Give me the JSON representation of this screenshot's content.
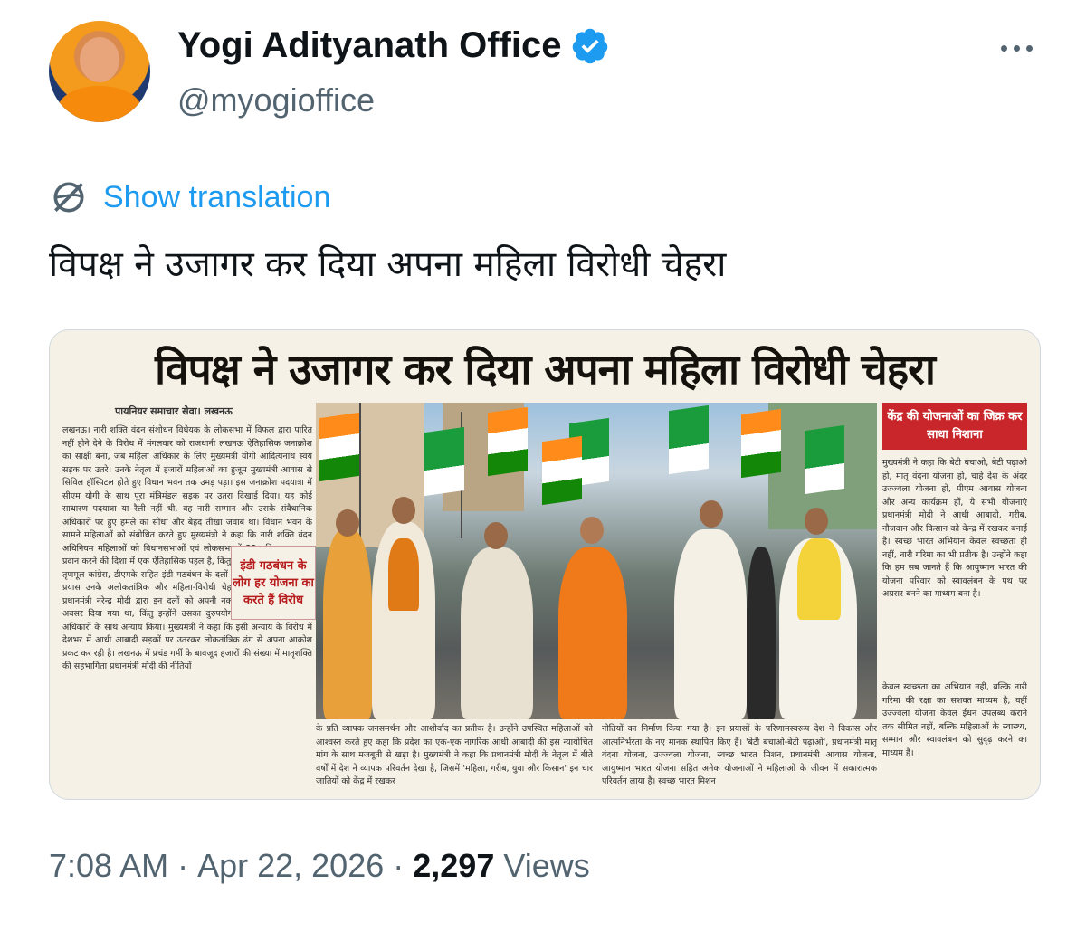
{
  "author": {
    "display_name": "Yogi Adityanath Office",
    "handle": "@myogioffice",
    "verified": true
  },
  "actions": {
    "more_icon": "more-horizontal-icon",
    "show_translation_label": "Show translation"
  },
  "tweet": {
    "text": "विपक्ष ने उजागर कर दिया अपना महिला विरोधी चेहरा"
  },
  "media": {
    "headline": "विपक्ष ने उजागर कर दिया अपना महिला विरोधी चेहरा",
    "byline": "पायनियर समाचार सेवा। लखनऊ",
    "inset": "इंडी गठबंधन के लोग हर योजना का करते हैं विरोध",
    "left_column": "लखनऊ। नारी शक्ति वंदन संशोधन विधेयक के लोकसभा में विफल द्वारा पारित नहीं होने देने के विरोध में मंगलवार को राजधानी लखनऊ ऐतिहासिक जनाक्रोश का साक्षी बना, जब महिला अधिकार के लिए मुख्यमंत्री योगी आदित्यनाथ स्वयं सड़क पर उतरे। उनके नेतृत्व में हजारों महिलाओं का हुजूम मुख्यमंत्री आवास से सिविल हॉस्पिटल होते हुए विधान भवन तक उमड़ पड़ा। इस जनाक्रोश पदयात्रा में सीएम योगी के साथ पूरा मंत्रिमंडल सड़क पर उतरा दिखाई दिया। यह कोई साधारण पदयात्रा या रैली नहीं थी, वह नारी सम्मान और उसके संवैधानिक अधिकारों पर हुए हमले का सीधा और बेहद तीखा जवाब था। विधान भवन के सामने महिलाओं को संबोधित करते हुए मुख्यमंत्री ने कहा कि नारी शक्ति वंदन अधिनियम महिलाओं को विधानसभाओं एवं लोकसभा में 33 प्रतिशत आरक्षण प्रदान करने की दिशा में एक ऐतिहासिक पहल है, किंतु कांग्रेस, समाजवादी पार्टी, तृणमूल कांग्रेस, डीएमके सहित इंडी गठबंधन के दलों द्वारा इसे बाधित करने का प्रयास उनके अलोकतांत्रिक और महिला-विरोधी चेहरे को उजागर करता है। प्रधानमंत्री नरेन्द्र मोदी द्वारा इन दलों को अपनी नकारात्मक छवि सुधारने का अवसर दिया गया था, किंतु इन्होंने उसका दुरुपयोग करते हुए महिलाओं के अधिकारों के साथ अन्याय किया। मुख्यमंत्री ने कहा कि इसी अन्याय के विरोध में देशभर में आधी आबादी सड़कों पर उतरकर लोकतांत्रिक ढंग से अपना आक्रोश प्रकट कर रही है। लखनऊ में प्रचंड गर्मी के बावजूद हजारों की संख्या में मातृशक्ति की सहभागिता प्रधानमंत्री मोदी की नीतियों",
    "caption_left": "के प्रति व्यापक जनसमर्थन और आशीर्वाद का प्रतीक है। उन्होंने उपस्थित महिलाओं को आश्वस्त करते हुए कहा कि प्रदेश का एक-एक नागरिक आधी आबादी की इस न्यायोचित मांग के साथ मजबूती से खड़ा है। मुख्यमंत्री ने कहा कि प्रधानमंत्री मोदी के नेतृत्व में बीते वर्षों में देश ने व्यापक परिवर्तन देखा है, जिसमें 'महिला, गरीब, युवा और किसान' इन चार जातियों को केंद्र में रखकर",
    "caption_right": "नीतियों का निर्माण किया गया है। इन प्रयासों के परिणामस्वरूप देश ने विकास और आत्मनिर्भरता के नए मानक स्थापित किए हैं। 'बेटी बचाओ-बेटी पढ़ाओ', प्रधानमंत्री मातृ वंदना योजना, उज्ज्वला योजना, स्वच्छ भारत मिशन, प्रधानमंत्री आवास योजना, आयुष्मान भारत योजना सहित अनेक योजनाओं ने महिलाओं के जीवन में सकारात्मक परिवर्तन लाया है। स्वच्छ भारत मिशन",
    "right_title": "केंद्र की योजनाओं का जिक्र कर साधा निशाना",
    "right_text": "मुख्यमंत्री ने कहा कि बेटी बचाओ, बेटी पढ़ाओ हो, मातृ वंदना योजना हो, चाहे देश के अंदर उज्ज्वला योजना हो, पीएम आवास योजना और अन्य कार्यक्रम हों, ये सभी योजनाएं प्रधानमंत्री मोदी ने आधी आबादी, गरीब, नौजवान और किसान को केन्द्र में रखकर बनाई है। स्वच्छ भारत अभियान केवल स्वच्छता ही नहीं, नारी गरिमा का भी प्रतीक है। उन्होंने कहा कि हम सब जानते हैं कि आयुष्मान भारत की योजना परिवार को स्वावलंबन के पथ पर अग्रसर बनने का माध्यम बना है।",
    "right_text_bottom": "केवल स्वच्छता का अभियान नहीं, बल्कि नारी गरिमा की रक्षा का सशक्त माध्यम है, वहीं उज्ज्वला योजना केवल ईंधन उपलब्ध कराने तक सीमित नहीं, बल्कि महिलाओं के स्वास्थ्य, सम्मान और स्वावलंबन को सुदृढ़ करने का माध्यम है।"
  },
  "meta": {
    "time": "7:08 AM",
    "separator": "·",
    "date": "Apr 22, 2026",
    "views_count": "2,297",
    "views_label": "Views"
  },
  "colors": {
    "link": "#1d9bf0",
    "verified": "#1d9bf0",
    "secondary_text": "#536471",
    "primary_text": "#0f1419",
    "news_red": "#c8262a"
  }
}
